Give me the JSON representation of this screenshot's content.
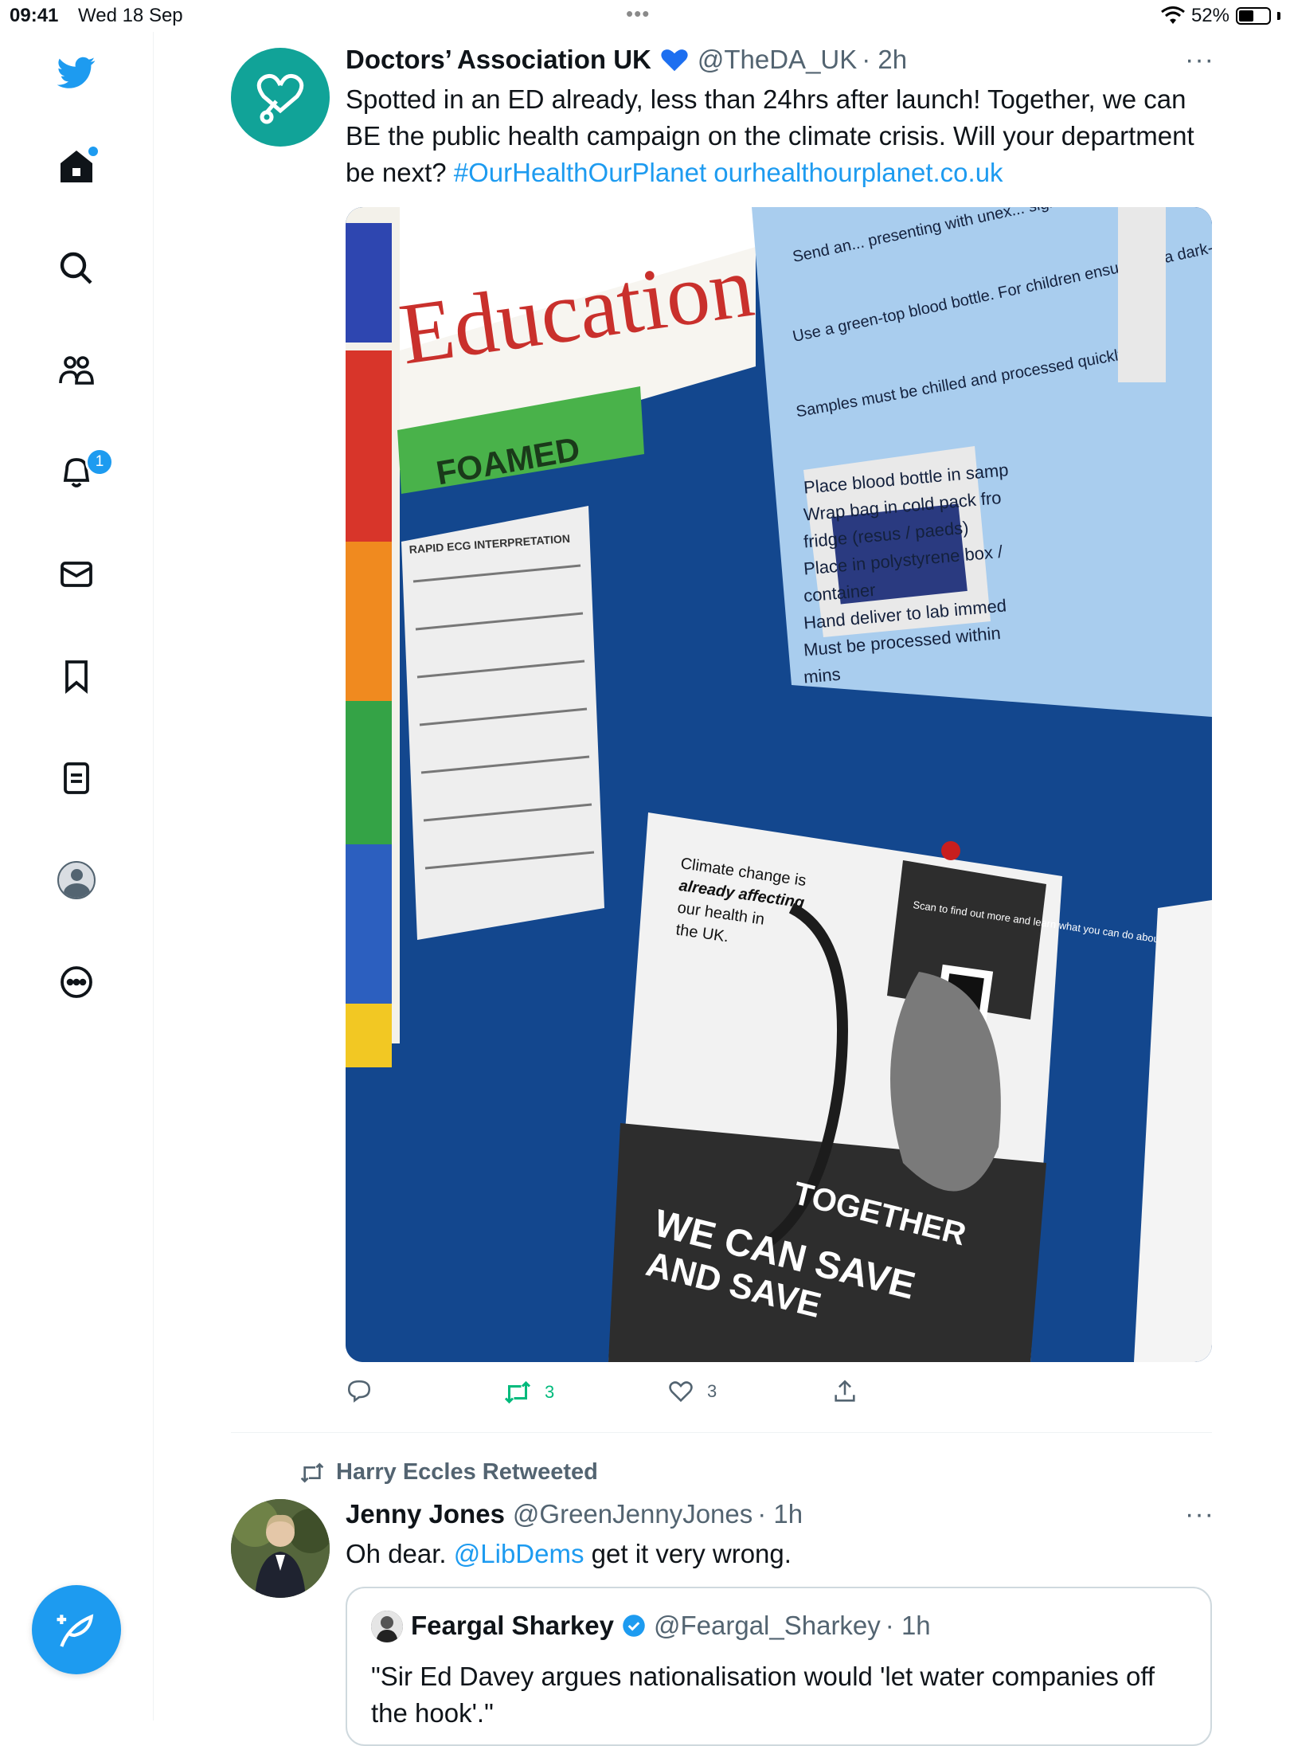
{
  "status_bar": {
    "time": "09:41",
    "date": "Wed 18 Sep",
    "battery": "52%"
  },
  "sidebar": {
    "notifications_badge": "1"
  },
  "tweet1": {
    "name": "Doctors’ Association UK",
    "handle": "@TheDA_UK",
    "time": "· 2h",
    "text": "Spotted in an ED already, less than 24hrs after launch! Together, we can BE the public health campaign on the climate crisis. Will your department be next?",
    "hashtag": "#OurHealthOurPlanet",
    "url": "ourhealthourplanet.co.uk",
    "retweets": "3",
    "likes": "3",
    "photo": {
      "education_sign": "Education",
      "foamed_tag": "FOAMED",
      "ecg_title": "RAPID ECG INTERPRETATION",
      "blue_text_1": "Send an... presenting with unex... signs of encephalopathy.",
      "blue_text_2": "Use a green-top blood bottle. For children ensure it is a dark-green screwtop.",
      "blue_text_3": "Samples must be chilled and processed quickly:",
      "bullets": [
        "Place blood bottle in samp",
        "Wrap bag in cold pack fro",
        "fridge (resus / paeds)",
        "Place in polystyrene box /",
        "container",
        "Hand deliver to lab immed",
        "Must be processed within",
        "mins"
      ],
      "poster_line1": "Climate change is",
      "poster_line2": "already affecting",
      "poster_line3": "our health in",
      "poster_line4": "the UK.",
      "scan_text": "Scan to find out more and learn what you can do about it",
      "poster_bottom1": "TOGETHER",
      "poster_bottom2": "WE CAN SAVE",
      "poster_bottom3": "AND SAVE"
    }
  },
  "tweet2": {
    "retweeted_by": "Harry Eccles Retweeted",
    "name": "Jenny Jones",
    "handle": "@GreenJennyJones",
    "time": "· 1h",
    "text_before": "Oh dear.",
    "mention": "@LibDems",
    "text_after": "get it very wrong.",
    "quote": {
      "name": "Feargal Sharkey",
      "handle": "@Feargal_Sharkey",
      "time": "· 1h",
      "text": "\"Sir Ed Davey argues nationalisation would 'let water companies off the hook'.\""
    }
  },
  "colors": {
    "accent": "#1d9bf0",
    "retweet_green": "#00ba7c",
    "avatar_teal": "#11a398"
  }
}
